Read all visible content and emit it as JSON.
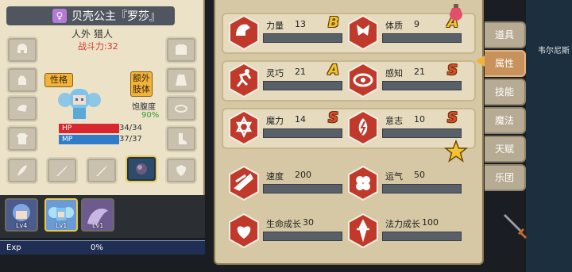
{
  "character": {
    "gender_icon": "female-symbol",
    "name": "贝壳公主『罗莎』",
    "class": "人外 猎人",
    "power_label": "战斗力:32",
    "tags": {
      "personality": "性格",
      "extra_limbs": "额外肢体"
    },
    "satiety_label": "饱腹度",
    "satiety_value": "90%",
    "hp": {
      "label": "HP",
      "value": "34/34",
      "fraction": 1.0
    },
    "mp": {
      "label": "MP",
      "value": "37/37",
      "fraction": 1.0
    }
  },
  "equipment_slots": [
    "helmet-icon",
    "armor-icon",
    "gauntlet-icon",
    "cape-icon",
    "shoulder-icon",
    "amulet-icon",
    "shirt-icon",
    "boots-icon",
    "weapon-left-icon",
    "sword-icon",
    "sword-icon",
    "orb-icon",
    "shield-icon"
  ],
  "party": [
    {
      "level": "Lv4"
    },
    {
      "level": "Lv1"
    },
    {
      "level": "Lv1"
    }
  ],
  "exp": {
    "label": "Exp",
    "value": "0%"
  },
  "stats": [
    {
      "name": "力量",
      "value": "13",
      "grade": "B",
      "icon": "muscle-icon"
    },
    {
      "name": "体质",
      "value": "9",
      "grade": "A",
      "icon": "body-icon"
    },
    {
      "name": "灵巧",
      "value": "21",
      "grade": "A",
      "icon": "runner-icon"
    },
    {
      "name": "感知",
      "value": "21",
      "grade": "S",
      "icon": "eye-icon"
    },
    {
      "name": "魔力",
      "value": "14",
      "grade": "S",
      "icon": "hexagram-icon"
    },
    {
      "name": "意志",
      "value": "10",
      "grade": "S",
      "icon": "will-icon"
    },
    {
      "name": "速度",
      "value": "200",
      "grade": "",
      "icon": "speed-icon"
    },
    {
      "name": "运气",
      "value": "50",
      "grade": "",
      "icon": "clover-icon"
    },
    {
      "name": "生命成长",
      "value": "30",
      "grade": "",
      "icon": "heart-growth-icon"
    },
    {
      "name": "法力成长",
      "value": "100",
      "grade": "",
      "icon": "mana-growth-icon"
    }
  ],
  "tabs": [
    {
      "label": "道具",
      "active": false
    },
    {
      "label": "属性",
      "active": true
    },
    {
      "label": "技能",
      "active": false
    },
    {
      "label": "魔法",
      "active": false
    },
    {
      "label": "天赋",
      "active": false
    },
    {
      "label": "乐团",
      "active": false
    }
  ],
  "npc_name": "韦尔尼斯",
  "colors": {
    "hp": "#d8282d",
    "mp": "#2f7cc9",
    "grade_gold": "#f4c430",
    "grade_red": "#e9472e",
    "stat_icon": "#c0392b"
  }
}
